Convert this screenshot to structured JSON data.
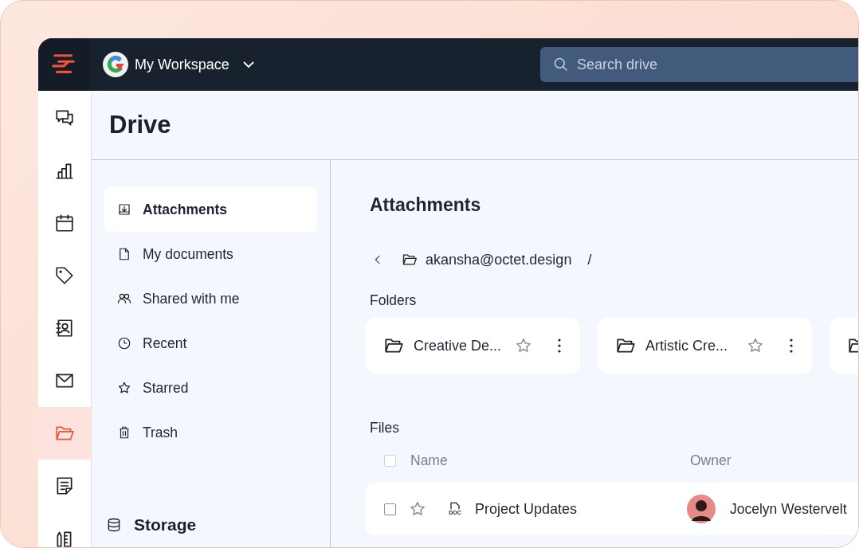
{
  "topbar": {
    "workspace": "My Workspace",
    "search": {
      "placeholder": "Search drive"
    }
  },
  "rail": [
    {
      "selected": false
    },
    {
      "selected": false
    },
    {
      "selected": false
    },
    {
      "selected": false
    },
    {
      "selected": false
    },
    {
      "selected": false
    },
    {
      "selected": true
    },
    {
      "selected": false
    },
    {
      "selected": false
    }
  ],
  "page_title": "Drive",
  "nav": {
    "items": [
      {
        "label": "Attachments",
        "selected": true
      },
      {
        "label": "My documents",
        "selected": false
      },
      {
        "label": "Shared with me",
        "selected": false
      },
      {
        "label": "Recent",
        "selected": false
      },
      {
        "label": "Starred",
        "selected": false
      },
      {
        "label": "Trash",
        "selected": false
      }
    ],
    "storage": "Storage"
  },
  "main": {
    "title": "Attachments",
    "breadcrumb": {
      "path": "akansha@octet.design",
      "separator": "/"
    },
    "folders_heading": "Folders",
    "folders": [
      {
        "kind": "card",
        "name": "Creative De...",
        "starred": false
      },
      {
        "kind": "card",
        "name": "Artistic Cre...",
        "starred": false
      },
      {
        "kind": "edge"
      }
    ],
    "files_heading": "Files",
    "header_checked": false,
    "columns": [
      "Name",
      "Owner"
    ],
    "files": [
      {
        "name": "Project Updates",
        "type": "DOC",
        "owner": "Jocelyn Westervelt",
        "checked": false,
        "starred": false
      }
    ]
  }
}
